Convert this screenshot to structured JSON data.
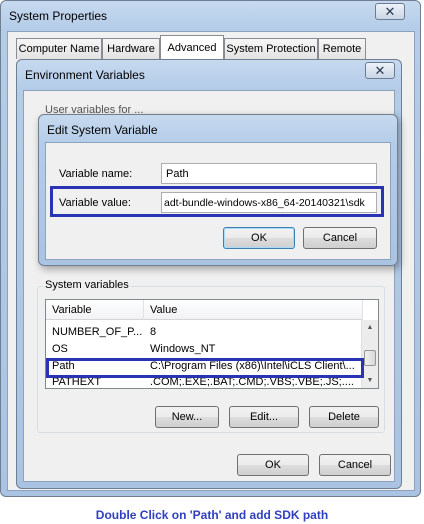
{
  "system_properties": {
    "title": "System Properties",
    "close_glyph": "✕",
    "tabs": [
      {
        "label": "Computer Name"
      },
      {
        "label": "Hardware"
      },
      {
        "label": "Advanced",
        "active": true
      },
      {
        "label": "System Protection"
      },
      {
        "label": "Remote"
      }
    ]
  },
  "environment_variables": {
    "title": "Environment Variables",
    "close_glyph": "✕",
    "user_group_partial": "User variables for ...",
    "system_group_label": "System variables",
    "columns": [
      "Variable",
      "Value"
    ],
    "rows": [
      {
        "variable": "NUMBER_OF_P...",
        "value": "8"
      },
      {
        "variable": "OS",
        "value": "Windows_NT"
      },
      {
        "variable": "Path",
        "value": "C:\\Program Files (x86)\\Intel\\iCLS Client\\..."
      },
      {
        "variable": "PATHEXT",
        "value": ".COM;.EXE;.BAT;.CMD;.VBS;.VBE;.JS;...."
      }
    ],
    "buttons": {
      "new": "New...",
      "edit": "Edit...",
      "delete": "Delete"
    },
    "ok": "OK",
    "cancel": "Cancel"
  },
  "edit_system_variable": {
    "title": "Edit System Variable",
    "close_glyph": "✕",
    "name_label": "Variable name:",
    "name_value": "Path",
    "value_label": "Variable value:",
    "value_value": "adt-bundle-windows-x86_64-20140321\\sdk",
    "ok": "OK",
    "cancel": "Cancel"
  },
  "caption": "Double Click on 'Path' and add SDK path",
  "colors": {
    "highlight": "#2b33b5",
    "caption": "#2f3fbf"
  }
}
